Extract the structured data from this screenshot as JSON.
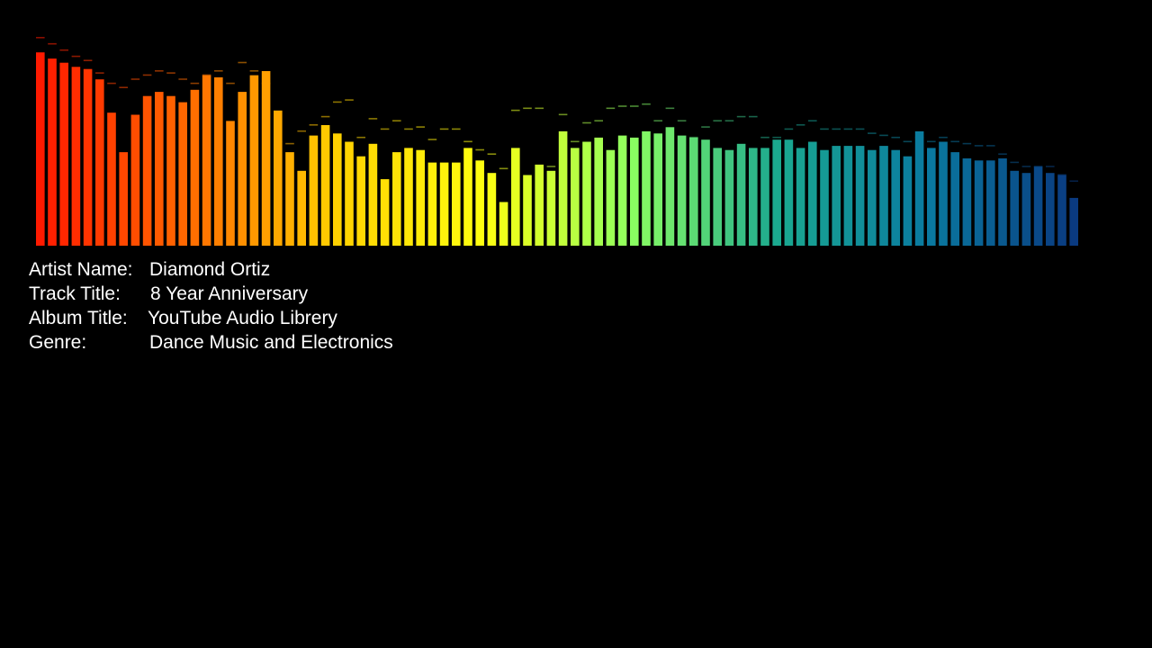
{
  "track_info": {
    "artist_label": "Artist Name:",
    "artist": "Diamond Ortiz",
    "track_label": "Track Title:",
    "track": "8 Year Anniversary",
    "album_label": "Album Title:",
    "album": "YouTube Audio Librery",
    "genre_label": "Genre:",
    "genre": "Dance Music and Electronics"
  },
  "colors": {
    "background": "#000000",
    "text": "#ffffff",
    "gradient_stops": [
      "#ff1a00",
      "#ff6a00",
      "#ffd000",
      "#ffff10",
      "#8cff60",
      "#1aa890",
      "#0a7aa0",
      "#0a3a80"
    ]
  },
  "chart_data": {
    "type": "bar",
    "ylim": [
      0,
      100
    ],
    "grid": false,
    "values": [
      93,
      90,
      88,
      86,
      85,
      80,
      64,
      45,
      63,
      72,
      74,
      72,
      69,
      75,
      82,
      81,
      60,
      74,
      82,
      84,
      65,
      45,
      36,
      53,
      58,
      54,
      50,
      43,
      49,
      32,
      45,
      47,
      46,
      40,
      40,
      40,
      47,
      41,
      35,
      21,
      47,
      34,
      39,
      36,
      55,
      47,
      50,
      52,
      46,
      53,
      52,
      55,
      54,
      57,
      53,
      52,
      51,
      47,
      46,
      49,
      47,
      47,
      51,
      51,
      47,
      50,
      46,
      48,
      48,
      48,
      46,
      48,
      46,
      43,
      55,
      47,
      50,
      45,
      42,
      41,
      41,
      42,
      36,
      35,
      38,
      35,
      34,
      23
    ],
    "peaks": [
      100,
      97,
      94,
      91,
      89,
      83,
      78,
      76,
      80,
      82,
      84,
      83,
      80,
      78,
      82,
      84,
      78,
      88,
      84,
      78,
      50,
      49,
      55,
      58,
      62,
      69,
      70,
      52,
      61,
      56,
      60,
      56,
      57,
      51,
      56,
      56,
      50,
      46,
      44,
      37,
      65,
      66,
      66,
      38,
      63,
      50,
      59,
      60,
      66,
      67,
      67,
      68,
      60,
      66,
      60,
      52,
      57,
      60,
      60,
      62,
      62,
      52,
      52,
      56,
      58,
      60,
      56,
      56,
      56,
      56,
      54,
      53,
      52,
      50,
      52,
      50,
      52,
      50,
      49,
      48,
      48,
      44,
      40,
      38,
      38,
      38,
      34,
      31
    ]
  }
}
